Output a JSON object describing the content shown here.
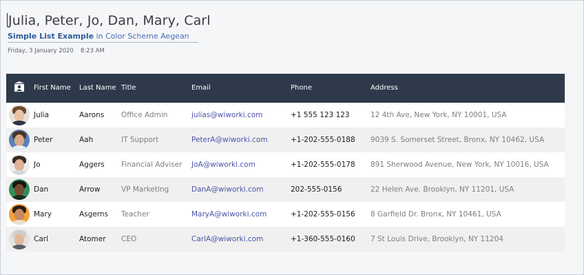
{
  "document": {
    "title": "Julia, Peter, Jo, Dan, Mary, Carl",
    "subtitle_bold": "Simple List Example",
    "subtitle_rest": " in Color Scheme Aegean",
    "date": "Friday, 3 January 2020",
    "time": "8:23 AM"
  },
  "table": {
    "headers": {
      "icon": "contact-card-icon",
      "first_name": "First Name",
      "last_name": "Last Name",
      "title": "Title",
      "email": "Email",
      "phone": "Phone",
      "address": "Address"
    },
    "rows": [
      {
        "avatar": "julia-avatar",
        "first": "Julia",
        "last": "Aarons",
        "title": "Office Admin",
        "email": "julias@wiworki.com",
        "phone": "+1 555 123 123",
        "address": "12 4th Ave, New York, NY 10001, USA"
      },
      {
        "avatar": "peter-avatar",
        "first": "Peter",
        "last": "Aah",
        "title": "IT Support",
        "email": "PeterA@wiworki.com",
        "phone": "+1-202-555-0188",
        "address": "9039 S. Somerset Street, Bronx, NY 10462, USA"
      },
      {
        "avatar": "jo-avatar",
        "first": "Jo",
        "last": "Aggers",
        "title": "Financial Adviser",
        "email": "JoA@wiworki.com",
        "phone": "+1-202-555-0178",
        "address": "891 Sherwood Avenue, New York, NY 10016, USA"
      },
      {
        "avatar": "dan-avatar",
        "first": "Dan",
        "last": "Arrow",
        "title": "VP Marketing",
        "email": "DanA@wiworki.com",
        "phone": "202-555-0156",
        "address": "22 Helen Ave. Brooklyn, NY 11201, USA"
      },
      {
        "avatar": "mary-avatar",
        "first": "Mary",
        "last": "Asgerns",
        "title": "Teacher",
        "email": "MaryA@wiworki.com",
        "phone": "+1-202-555-0156",
        "address": "8 Garfield Dr. Bronx, NY 10461, USA"
      },
      {
        "avatar": "carl-avatar",
        "first": "Carl",
        "last": "Atomer",
        "title": "CEO",
        "email": "CarlA@wiworki.com",
        "phone": "+1-360-555-0160",
        "address": "7 St Louis Drive, Brooklyn, NY 11204"
      }
    ]
  },
  "colors": {
    "header_bg": "#2e3a4b",
    "accent_blue": "#2e5d9c",
    "email_link": "#4b55a8"
  }
}
